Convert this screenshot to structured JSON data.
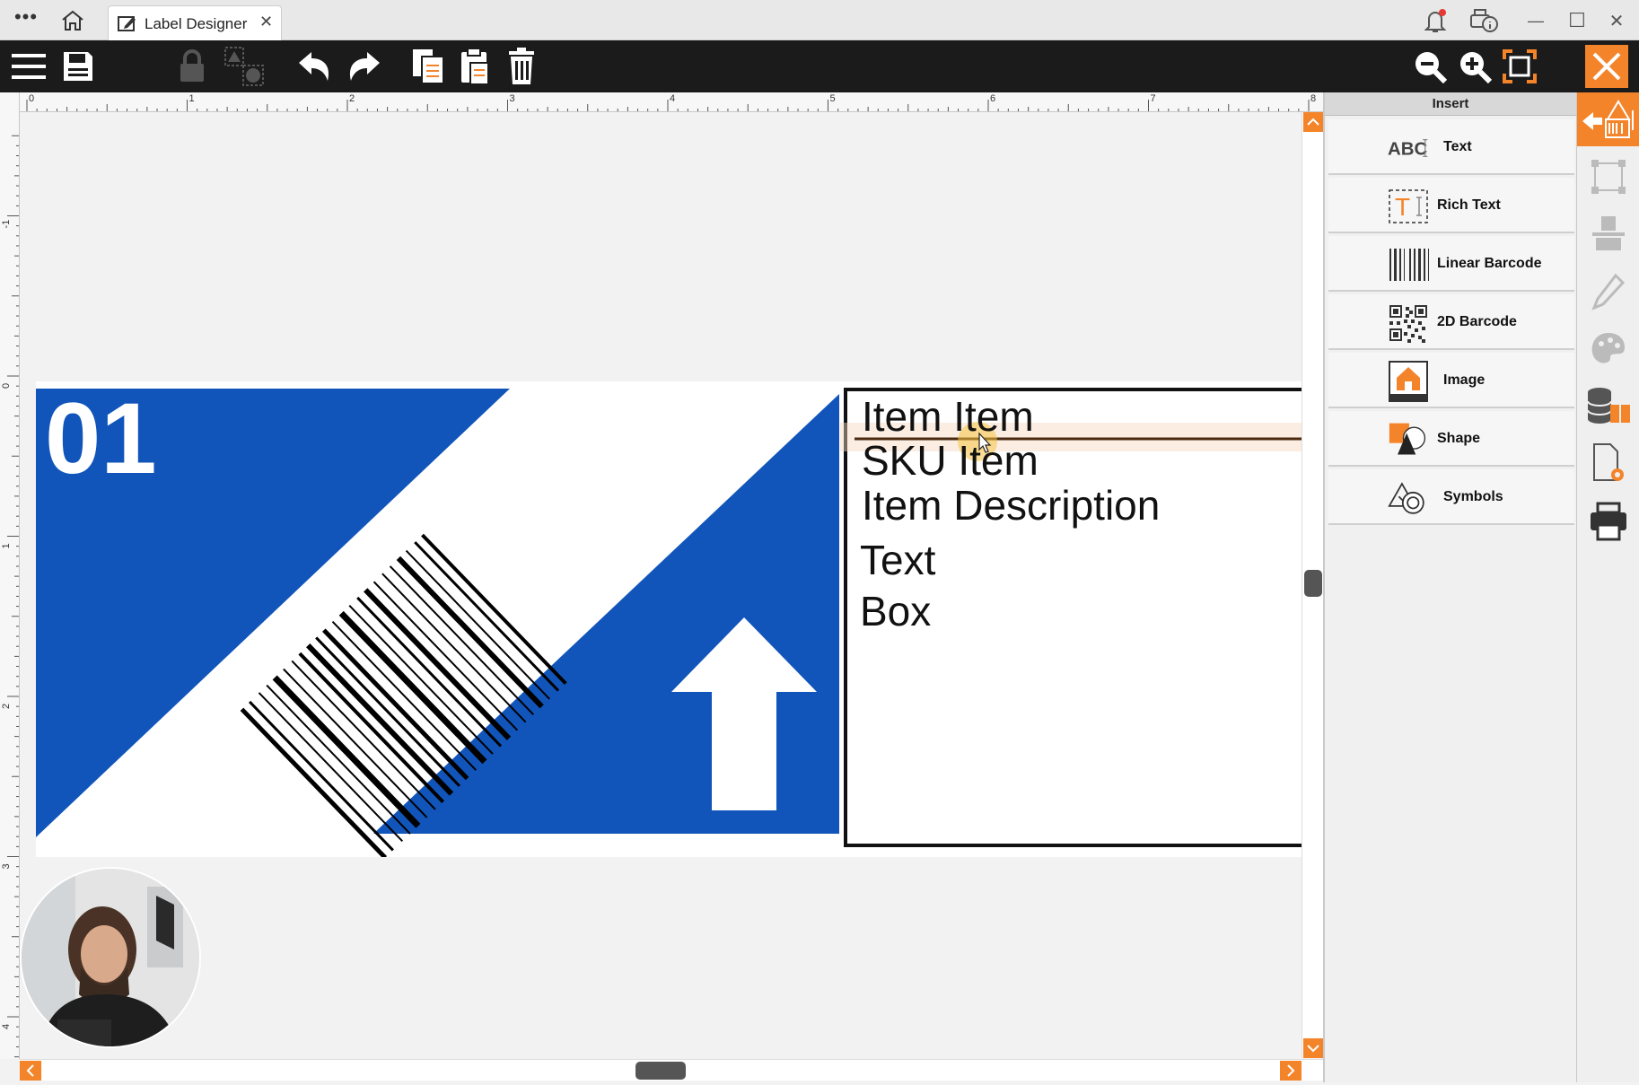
{
  "window": {
    "menu_dots": "•••",
    "tab_title": "Label Designer",
    "tab_close": "✕",
    "minimize": "—",
    "maximize": "☐",
    "close": "✕"
  },
  "toolbar": {
    "icons": [
      "menu-icon",
      "save-icon",
      "lock-icon",
      "group-icon",
      "undo-icon",
      "redo-icon",
      "copy-icon",
      "paste-icon",
      "delete-icon",
      "zoom-out-icon",
      "zoom-in-icon",
      "fit-icon",
      "close-icon"
    ]
  },
  "rulers": {
    "h_labels": [
      "0",
      "1",
      "2",
      "3",
      "4",
      "5",
      "6",
      "7",
      "8"
    ],
    "v_labels": [
      "-1",
      "0",
      "1",
      "2",
      "3",
      "4"
    ]
  },
  "label": {
    "number": "01",
    "text_box_lines": [
      "Item  Item",
      "SKU  Item",
      "Item Description",
      "Text",
      "Box"
    ],
    "colors": {
      "blue": "#1155bb",
      "accent": "#f4842a"
    }
  },
  "insert_panel": {
    "header": "Insert",
    "items": [
      {
        "label": "Text",
        "icon": "text-abc-icon"
      },
      {
        "label": "Rich Text",
        "icon": "rich-text-icon"
      },
      {
        "label": "Linear Barcode",
        "icon": "linear-barcode-icon"
      },
      {
        "label": "2D Barcode",
        "icon": "qr-code-icon"
      },
      {
        "label": "Image",
        "icon": "image-icon"
      },
      {
        "label": "Shape",
        "icon": "shape-icon"
      },
      {
        "label": "Symbols",
        "icon": "symbols-icon"
      }
    ],
    "abc_text": "ABC"
  },
  "side_rail": {
    "icons": [
      "insert-icon",
      "select-frame-icon",
      "align-icon",
      "pencil-icon",
      "palette-icon",
      "database-icon",
      "page-settings-icon",
      "print-icon"
    ]
  }
}
